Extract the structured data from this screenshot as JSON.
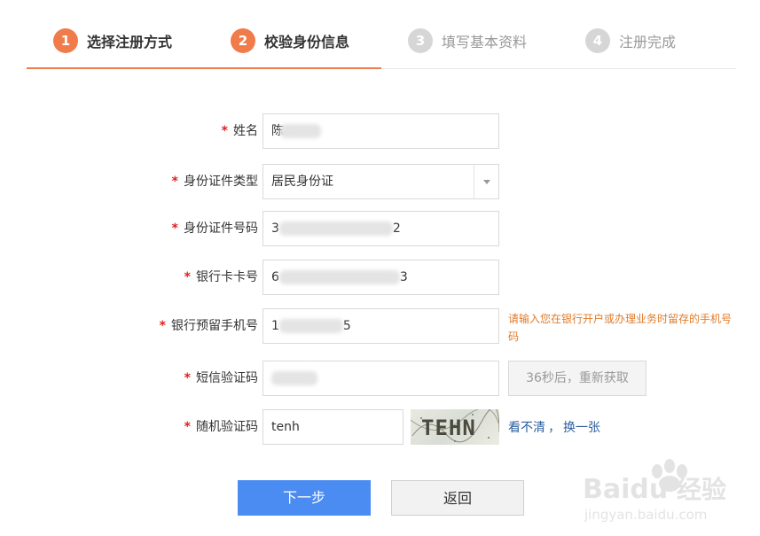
{
  "steps": [
    {
      "num": "1",
      "label": "选择注册方式",
      "state": "active"
    },
    {
      "num": "2",
      "label": "校验身份信息",
      "state": "active"
    },
    {
      "num": "3",
      "label": "填写基本资料",
      "state": "pending"
    },
    {
      "num": "4",
      "label": "注册完成",
      "state": "pending"
    }
  ],
  "form": {
    "required_mark": "*",
    "name": {
      "label": "姓名",
      "value_prefix": "陈"
    },
    "id_type": {
      "label": "身份证件类型",
      "value": "居民身份证"
    },
    "id_number": {
      "label": "身份证件号码",
      "value_prefix": "3",
      "value_suffix": "2"
    },
    "bank_card": {
      "label": "银行卡卡号",
      "value_prefix": "6",
      "value_suffix": "3"
    },
    "phone": {
      "label": "银行预留手机号",
      "value_prefix": "1",
      "value_suffix": "5",
      "hint": "请输入您在银行开户或办理业务时留存的手机号码"
    },
    "sms_code": {
      "label": "短信验证码",
      "resend_label": "36秒后，重新获取"
    },
    "captcha": {
      "label": "随机验证码",
      "value": "tenh",
      "image_text": "TEHN",
      "refresh_part1": "看不清",
      "refresh_sep": "，",
      "refresh_part2": "换一张"
    }
  },
  "buttons": {
    "next": "下一步",
    "back": "返回"
  },
  "watermark": {
    "brand": "Baidu",
    "brand_cn": "经验",
    "url": "jingyan.baidu.com"
  },
  "colors": {
    "accent": "#f07c4c",
    "primary_button": "#4a8cf1",
    "hint": "#e07b2a",
    "link": "#2a5f9e",
    "required": "#e02020"
  }
}
